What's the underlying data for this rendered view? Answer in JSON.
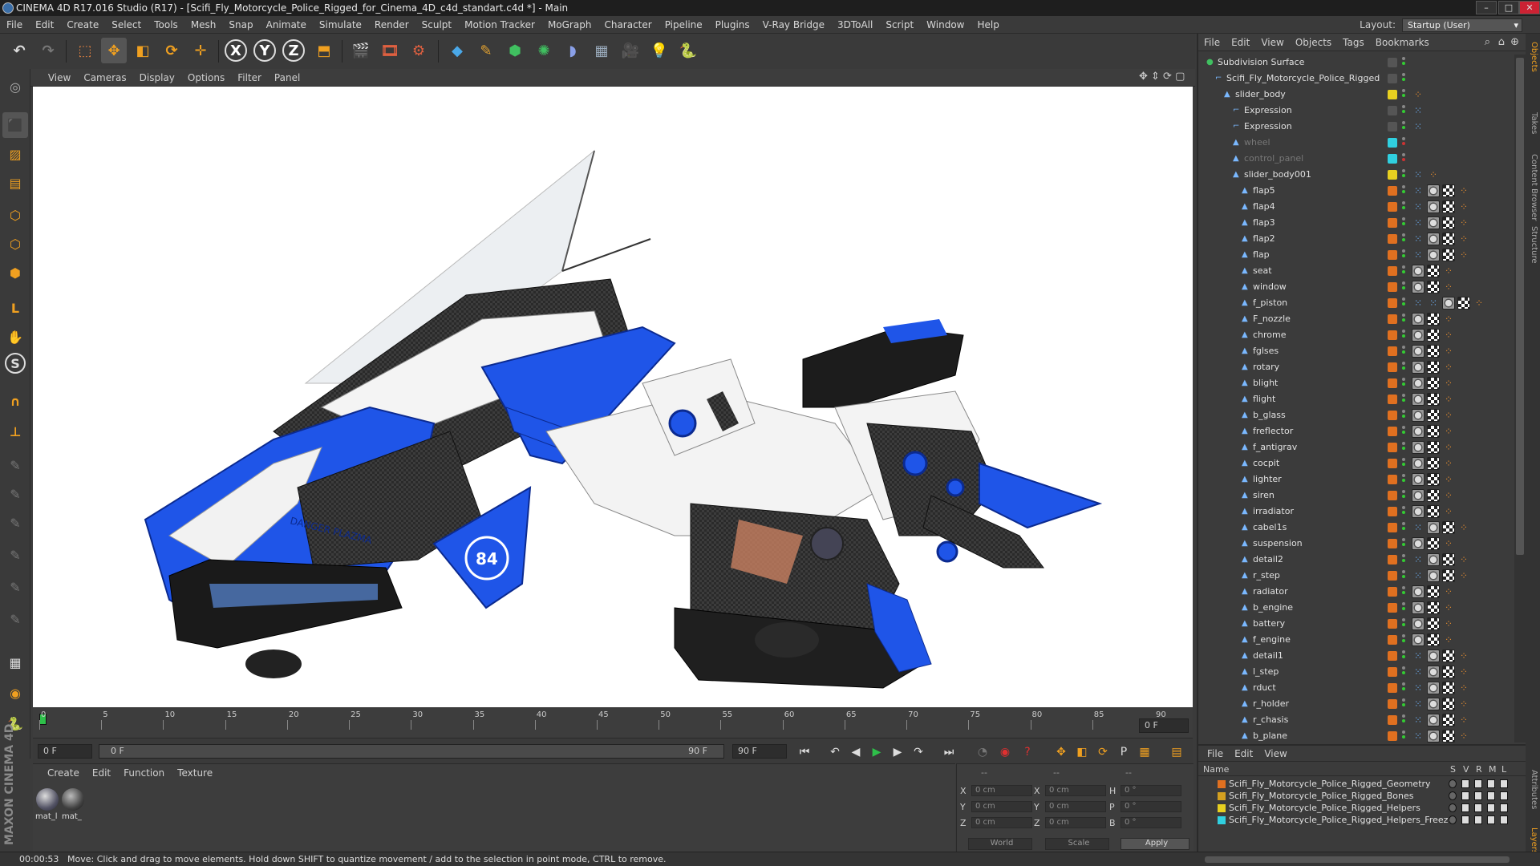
{
  "window": {
    "title": "CINEMA 4D R17.016 Studio (R17) - [Scifi_Fly_Motorcycle_Police_Rigged_for_Cinema_4D_c4d_standart.c4d *] - Main"
  },
  "menubar": {
    "items": [
      "File",
      "Edit",
      "Create",
      "Select",
      "Tools",
      "Mesh",
      "Snap",
      "Animate",
      "Simulate",
      "Render",
      "Sculpt",
      "Motion Tracker",
      "MoGraph",
      "Character",
      "Pipeline",
      "Plugins",
      "V-Ray Bridge",
      "3DToAll",
      "Script",
      "Window",
      "Help"
    ],
    "layout_label": "Layout:",
    "layout_value": "Startup (User)"
  },
  "viewport": {
    "menu": [
      "View",
      "Cameras",
      "Display",
      "Options",
      "Filter",
      "Panel"
    ],
    "decal_danger": "DANGER PLAZMA",
    "decal_number": "84"
  },
  "timeline": {
    "ticks": [
      "0",
      "5",
      "10",
      "15",
      "20",
      "25",
      "30",
      "35",
      "40",
      "45",
      "50",
      "55",
      "60",
      "65",
      "70",
      "75",
      "80",
      "85",
      "90"
    ],
    "current_frame": "0 F",
    "start_field": "0 F",
    "range_start": "0 F",
    "range_end": "90 F",
    "end_field": "90 F"
  },
  "material_manager": {
    "menu": [
      "Create",
      "Edit",
      "Function",
      "Texture"
    ],
    "materials": [
      "mat_l",
      "mat_"
    ]
  },
  "coordinates": {
    "header_left": "--",
    "header_mid": "--",
    "header_right": "--",
    "rows": [
      {
        "a": "X",
        "av": "0 cm",
        "b": "X",
        "bv": "0 cm",
        "c": "H",
        "cv": "0 °"
      },
      {
        "a": "Y",
        "av": "0 cm",
        "b": "Y",
        "bv": "0 cm",
        "c": "P",
        "cv": "0 °"
      },
      {
        "a": "Z",
        "av": "0 cm",
        "b": "Z",
        "bv": "0 cm",
        "c": "B",
        "cv": "0 °"
      }
    ],
    "mode": "World",
    "scale": "Scale",
    "apply": "Apply"
  },
  "status": {
    "time": "00:00:53",
    "message": "Move: Click and drag to move elements. Hold down SHIFT to quantize movement / add to the selection in point mode, CTRL to remove."
  },
  "branding": "MAXON CINEMA 4D",
  "object_manager": {
    "menu": [
      "File",
      "Edit",
      "View",
      "Objects",
      "Tags",
      "Bookmarks"
    ],
    "objects": [
      {
        "name": "Subdivision Surface",
        "depth": 0,
        "dim": false,
        "sw": "none",
        "tags": []
      },
      {
        "name": "Scifi_Fly_Motorcycle_Police_Rigged",
        "depth": 1,
        "dim": false,
        "sw": "none",
        "tags": []
      },
      {
        "name": "slider_body",
        "depth": 2,
        "dim": false,
        "sw": "#e8d020",
        "tags": [
          "ik"
        ]
      },
      {
        "name": "Expression",
        "depth": 3,
        "dim": false,
        "sw": "none",
        "tags": [
          "xp"
        ]
      },
      {
        "name": "Expression",
        "depth": 3,
        "dim": false,
        "sw": "none",
        "tags": [
          "xp"
        ]
      },
      {
        "name": "wheel",
        "depth": 3,
        "dim": true,
        "sw": "#30d0e0",
        "tags": []
      },
      {
        "name": "control_panel",
        "depth": 3,
        "dim": true,
        "sw": "#30d0e0",
        "tags": []
      },
      {
        "name": "slider_body001",
        "depth": 3,
        "dim": false,
        "sw": "#e8d020",
        "tags": [
          "xp",
          "ik"
        ]
      },
      {
        "name": "flap5",
        "depth": 4,
        "dim": false,
        "sw": "#e07020",
        "tags": [
          "xp",
          "tex",
          "chk",
          "ik"
        ]
      },
      {
        "name": "flap4",
        "depth": 4,
        "dim": false,
        "sw": "#e07020",
        "tags": [
          "xp",
          "tex",
          "chk",
          "ik"
        ]
      },
      {
        "name": "flap3",
        "depth": 4,
        "dim": false,
        "sw": "#e07020",
        "tags": [
          "xp",
          "tex",
          "chk",
          "ik"
        ]
      },
      {
        "name": "flap2",
        "depth": 4,
        "dim": false,
        "sw": "#e07020",
        "tags": [
          "xp",
          "tex",
          "chk",
          "ik"
        ]
      },
      {
        "name": "flap",
        "depth": 4,
        "dim": false,
        "sw": "#e07020",
        "tags": [
          "xp",
          "tex",
          "chk",
          "ik"
        ]
      },
      {
        "name": "seat",
        "depth": 4,
        "dim": false,
        "sw": "#e07020",
        "tags": [
          "tex",
          "chk",
          "ik"
        ]
      },
      {
        "name": "window",
        "depth": 4,
        "dim": false,
        "sw": "#e07020",
        "tags": [
          "tex",
          "chk",
          "ik"
        ]
      },
      {
        "name": "f_piston",
        "depth": 4,
        "dim": false,
        "sw": "#e07020",
        "tags": [
          "xp",
          "xp",
          "tex",
          "chk",
          "ik"
        ]
      },
      {
        "name": "F_nozzle",
        "depth": 4,
        "dim": false,
        "sw": "#e07020",
        "tags": [
          "tex",
          "chk",
          "ik"
        ]
      },
      {
        "name": "chrome",
        "depth": 4,
        "dim": false,
        "sw": "#e07020",
        "tags": [
          "tex",
          "chk",
          "ik"
        ]
      },
      {
        "name": "fglses",
        "depth": 4,
        "dim": false,
        "sw": "#e07020",
        "tags": [
          "tex",
          "chk",
          "ik"
        ]
      },
      {
        "name": "rotary",
        "depth": 4,
        "dim": false,
        "sw": "#e07020",
        "tags": [
          "tex",
          "chk",
          "ik"
        ]
      },
      {
        "name": "blight",
        "depth": 4,
        "dim": false,
        "sw": "#e07020",
        "tags": [
          "tex",
          "chk",
          "ik"
        ]
      },
      {
        "name": "flight",
        "depth": 4,
        "dim": false,
        "sw": "#e07020",
        "tags": [
          "tex",
          "chk",
          "ik"
        ]
      },
      {
        "name": "b_glass",
        "depth": 4,
        "dim": false,
        "sw": "#e07020",
        "tags": [
          "tex",
          "chk",
          "ik"
        ]
      },
      {
        "name": "freflector",
        "depth": 4,
        "dim": false,
        "sw": "#e07020",
        "tags": [
          "tex",
          "chk",
          "ik"
        ]
      },
      {
        "name": "f_antigrav",
        "depth": 4,
        "dim": false,
        "sw": "#e07020",
        "tags": [
          "tex",
          "chk",
          "ik"
        ]
      },
      {
        "name": "cocpit",
        "depth": 4,
        "dim": false,
        "sw": "#e07020",
        "tags": [
          "tex",
          "chk",
          "ik"
        ]
      },
      {
        "name": "lighter",
        "depth": 4,
        "dim": false,
        "sw": "#e07020",
        "tags": [
          "tex",
          "chk",
          "ik"
        ]
      },
      {
        "name": "siren",
        "depth": 4,
        "dim": false,
        "sw": "#e07020",
        "tags": [
          "tex",
          "chk",
          "ik"
        ]
      },
      {
        "name": "irradiator",
        "depth": 4,
        "dim": false,
        "sw": "#e07020",
        "tags": [
          "tex",
          "chk",
          "ik"
        ]
      },
      {
        "name": "cabel1s",
        "depth": 4,
        "dim": false,
        "sw": "#e07020",
        "tags": [
          "xp",
          "tex",
          "chk",
          "ik"
        ]
      },
      {
        "name": "suspension",
        "depth": 4,
        "dim": false,
        "sw": "#e07020",
        "tags": [
          "tex",
          "chk",
          "ik"
        ]
      },
      {
        "name": "detail2",
        "depth": 4,
        "dim": false,
        "sw": "#e07020",
        "tags": [
          "xp",
          "tex",
          "chk",
          "ik"
        ]
      },
      {
        "name": "r_step",
        "depth": 4,
        "dim": false,
        "sw": "#e07020",
        "tags": [
          "xp",
          "tex",
          "chk",
          "ik"
        ]
      },
      {
        "name": "radiator",
        "depth": 4,
        "dim": false,
        "sw": "#e07020",
        "tags": [
          "tex",
          "chk",
          "ik"
        ]
      },
      {
        "name": "b_engine",
        "depth": 4,
        "dim": false,
        "sw": "#e07020",
        "tags": [
          "tex",
          "chk",
          "ik"
        ]
      },
      {
        "name": "battery",
        "depth": 4,
        "dim": false,
        "sw": "#e07020",
        "tags": [
          "tex",
          "chk",
          "ik"
        ]
      },
      {
        "name": "f_engine",
        "depth": 4,
        "dim": false,
        "sw": "#e07020",
        "tags": [
          "tex",
          "chk",
          "ik"
        ]
      },
      {
        "name": "detail1",
        "depth": 4,
        "dim": false,
        "sw": "#e07020",
        "tags": [
          "xp",
          "tex",
          "chk",
          "ik"
        ]
      },
      {
        "name": "l_step",
        "depth": 4,
        "dim": false,
        "sw": "#e07020",
        "tags": [
          "xp",
          "tex",
          "chk",
          "ik"
        ]
      },
      {
        "name": "rduct",
        "depth": 4,
        "dim": false,
        "sw": "#e07020",
        "tags": [
          "xp",
          "tex",
          "chk",
          "ik"
        ]
      },
      {
        "name": "r_holder",
        "depth": 4,
        "dim": false,
        "sw": "#e07020",
        "tags": [
          "xp",
          "tex",
          "chk",
          "ik"
        ]
      },
      {
        "name": "r_chasis",
        "depth": 4,
        "dim": false,
        "sw": "#e07020",
        "tags": [
          "xp",
          "tex",
          "chk",
          "ik"
        ]
      },
      {
        "name": "b_plane",
        "depth": 4,
        "dim": false,
        "sw": "#e07020",
        "tags": [
          "xp",
          "tex",
          "chk",
          "ik"
        ]
      }
    ]
  },
  "layer_manager": {
    "menu": [
      "File",
      "Edit",
      "View"
    ],
    "header_name": "Name",
    "header_flags": [
      "S",
      "V",
      "R",
      "M",
      "L"
    ],
    "layers": [
      {
        "name": "Scifi_Fly_Motorcycle_Police_Rigged_Geometry",
        "color": "#e07020"
      },
      {
        "name": "Scifi_Fly_Motorcycle_Police_Rigged_Bones",
        "color": "#d4a020"
      },
      {
        "name": "Scifi_Fly_Motorcycle_Police_Rigged_Helpers",
        "color": "#e8d020"
      },
      {
        "name": "Scifi_Fly_Motorcycle_Police_Rigged_Helpers_Freeze",
        "color": "#30d0e0"
      }
    ]
  },
  "side_tabs": [
    "Objects",
    "Takes",
    "Content Browser",
    "Structure",
    "Attributes",
    "Layers"
  ]
}
